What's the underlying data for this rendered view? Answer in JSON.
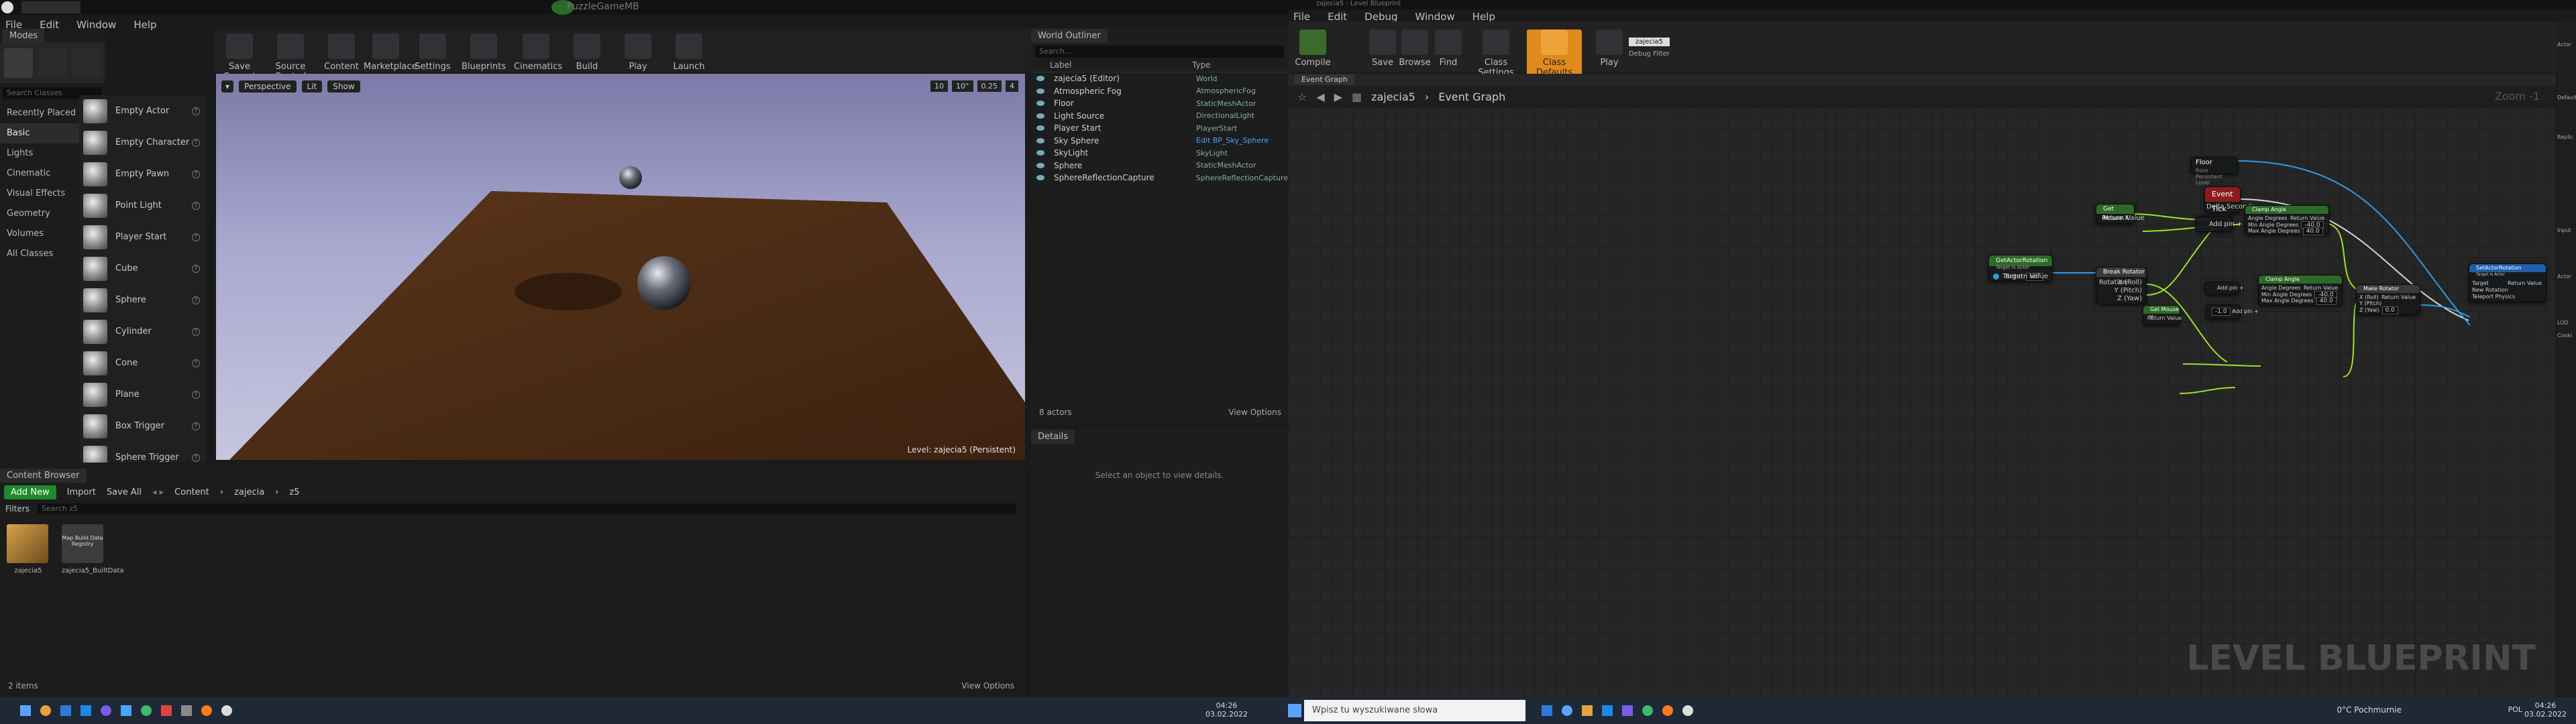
{
  "left": {
    "tabs": {
      "project": "PuzzleGameMB"
    },
    "menu": [
      "File",
      "Edit",
      "Window",
      "Help"
    ],
    "modes_tab": "Modes",
    "search_placeholder": "Search Classes",
    "categories": [
      "Recently Placed",
      "Basic",
      "Lights",
      "Cinematic",
      "Visual Effects",
      "Geometry",
      "Volumes",
      "All Classes"
    ],
    "place_items": [
      "Empty Actor",
      "Empty Character",
      "Empty Pawn",
      "Point Light",
      "Player Start",
      "Cube",
      "Sphere",
      "Cylinder",
      "Cone",
      "Plane",
      "Box Trigger",
      "Sphere Trigger"
    ],
    "toolbar": [
      "Save Current",
      "Source Control",
      "Content",
      "Marketplace",
      "Settings",
      "Blueprints",
      "Cinematics",
      "Build",
      "Play",
      "Launch"
    ],
    "viewport": {
      "perspective": "Perspective",
      "lit": "Lit",
      "show": "Show",
      "level_label": "Level:",
      "level_name": "zajecia5 (Persistent)",
      "snap_grid": "10",
      "snap_angle": "10°",
      "snap_scale": "0.25",
      "cam_speed": "4"
    },
    "outliner": {
      "title": "World Outliner",
      "search": "Search...",
      "col_label": "Label",
      "col_type": "Type",
      "rows": [
        [
          "zajecia5 (Editor)",
          "World"
        ],
        [
          "Atmospheric Fog",
          "AtmosphericFog"
        ],
        [
          "Floor",
          "StaticMeshActor"
        ],
        [
          "Light Source",
          "DirectionalLight"
        ],
        [
          "Player Start",
          "PlayerStart"
        ],
        [
          "Sky Sphere",
          "Edit BP_Sky_Sphere"
        ],
        [
          "SkyLight",
          "SkyLight"
        ],
        [
          "Sphere",
          "StaticMeshActor"
        ],
        [
          "SphereReflectionCapture",
          "SphereReflectionCapture"
        ]
      ],
      "count": "8 actors",
      "view_options": "View Options"
    },
    "details": {
      "title": "Details",
      "empty": "Select an object to view details."
    },
    "content_browser": {
      "title": "Content Browser",
      "add_new": "Add New",
      "import": "Import",
      "save_all": "Save All",
      "path": [
        "Content",
        "zajecia",
        "z5"
      ],
      "filters": "Filters",
      "search": "Search z5",
      "assets": [
        {
          "name": "zajecia5"
        },
        {
          "name": "zajecia5_BuiltData",
          "badge": "Map Build Data Registry"
        }
      ],
      "count": "2 items",
      "view_options": "View Options"
    },
    "taskbar": {
      "time": "04:26",
      "date": "03.02.2022"
    }
  },
  "right": {
    "title": "zajecia5 - Level Blueprint",
    "menu": [
      "File",
      "Edit",
      "Debug",
      "Window",
      "Help"
    ],
    "toolbar": [
      "Compile",
      "Save",
      "Browse",
      "Find",
      "Class Settings",
      "Class Defaults",
      "Play"
    ],
    "debug": {
      "value": "zajecia5",
      "label": "Debug Filter"
    },
    "graph_tab": "Event Graph",
    "breadcrumb": {
      "root": "zajecia5",
      "current": "Event Graph"
    },
    "zoom": "Zoom -1",
    "watermark": "LEVEL BLUEPRINT",
    "nodes": {
      "event_tick": {
        "title": "Event Tick",
        "pin": "Delta Seconds"
      },
      "floor": {
        "title": "Floor",
        "sub": "from Persistent Level"
      },
      "get_mouse_x": {
        "title": "Get Mouse X",
        "pin": "Return Value"
      },
      "get_mouse_y": {
        "title": "Get Mouse Y",
        "pin": "Return Value"
      },
      "get_actor_rotation": {
        "title": "GetActorRotation",
        "sub": "Target is Actor",
        "target": "Target",
        "self": "self",
        "ret": "Return Value"
      },
      "break_rotator": {
        "title": "Break Rotator",
        "in": "Rotation",
        "x": "X (Roll)",
        "y": "Y (Pitch)",
        "z": "Z (Yaw)"
      },
      "clamp1": {
        "title": "Clamp Angle",
        "a": "Angle Degrees",
        "min": "Min Angle Degrees",
        "minv": "-40.0",
        "max": "Max Angle Degrees",
        "maxv": "40.0",
        "ret": "Return Value"
      },
      "clamp2": {
        "title": "Clamp Angle",
        "a": "Angle Degrees",
        "min": "Min Angle Degrees",
        "minv": "-40.0",
        "max": "Max Angle Degrees",
        "maxv": "40.0",
        "ret": "Return Value"
      },
      "add1": {
        "label": "Add pin"
      },
      "add2": {
        "label": "Add pin"
      },
      "add3": {
        "label": "Add pin",
        "val": "-1.0"
      },
      "make_rotator": {
        "title": "Make Rotator",
        "x": "X (Roll)",
        "y": "Y (Pitch)",
        "z": "Z (Yaw)",
        "zv": "0.0",
        "ret": "Return Value"
      },
      "set_actor_rotation": {
        "title": "SetActorRotation",
        "sub": "Target is Actor",
        "target": "Target",
        "new": "New Rotation",
        "tp": "Teleport Physics",
        "ret": "Return Value"
      }
    },
    "details_side": [
      "Actor",
      "Default",
      "Replic",
      "Input",
      "Actor",
      "LOD",
      "Cooki"
    ],
    "taskbar": {
      "search": "Wpisz tu wyszukiwane słowa",
      "weather": "0°C Pochmurnie",
      "lang": "POL",
      "time": "04:26",
      "date": "03.02.2022"
    }
  }
}
